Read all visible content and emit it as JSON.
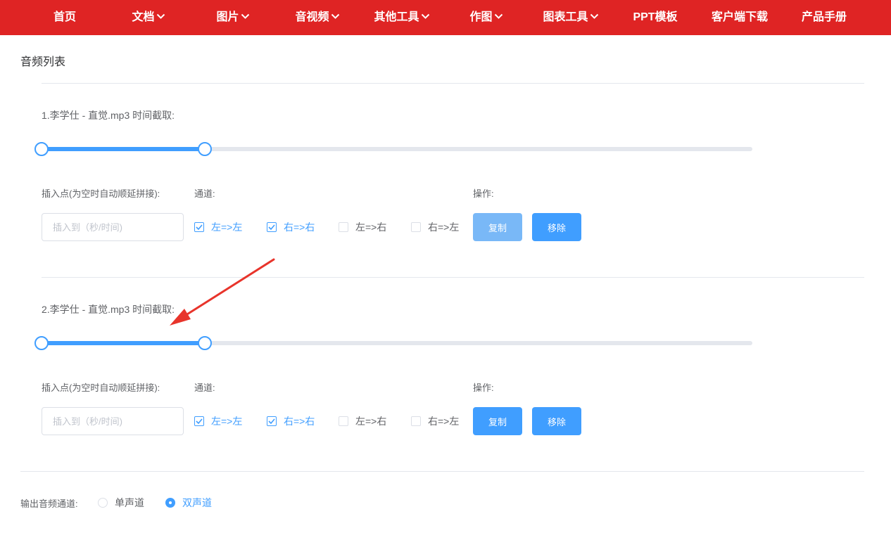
{
  "nav": {
    "items": [
      {
        "label": "首页",
        "dropdown": false
      },
      {
        "label": "文档",
        "dropdown": true
      },
      {
        "label": "图片",
        "dropdown": true
      },
      {
        "label": "音视频",
        "dropdown": true
      },
      {
        "label": "其他工具",
        "dropdown": true
      },
      {
        "label": "作图",
        "dropdown": true
      },
      {
        "label": "图表工具",
        "dropdown": true
      },
      {
        "label": "PPT模板",
        "dropdown": false
      },
      {
        "label": "客户端下载",
        "dropdown": false
      },
      {
        "label": "产品手册",
        "dropdown": false
      }
    ]
  },
  "page": {
    "title": "音频列表"
  },
  "colors": {
    "nav_bg": "#df2424",
    "accent": "#409eff",
    "annotation_arrow": "#e8342b"
  },
  "tracks": [
    {
      "label": "1.李学仕 - 直觉.mp3 时间截取:",
      "slider_range": [
        0,
        0.23
      ],
      "insert_label": "插入点(为空时自动顺延拼接):",
      "insert_placeholder": "插入到（秒/时间)",
      "channel_label": "通道:",
      "channels": [
        {
          "label": "左=>左",
          "checked": true
        },
        {
          "label": "右=>右",
          "checked": true
        },
        {
          "label": "左=>右",
          "checked": false
        },
        {
          "label": "右=>左",
          "checked": false
        }
      ],
      "ops_label": "操作:",
      "copy_label": "复制",
      "copy_disabled": true,
      "remove_label": "移除"
    },
    {
      "label": "2.李学仕 - 直觉.mp3 时间截取:",
      "slider_range": [
        0,
        0.23
      ],
      "insert_label": "插入点(为空时自动顺延拼接):",
      "insert_placeholder": "插入到（秒/时间)",
      "channel_label": "通道:",
      "channels": [
        {
          "label": "左=>左",
          "checked": true
        },
        {
          "label": "右=>右",
          "checked": true
        },
        {
          "label": "左=>右",
          "checked": false
        },
        {
          "label": "右=>左",
          "checked": false
        }
      ],
      "ops_label": "操作:",
      "copy_label": "复制",
      "copy_disabled": false,
      "remove_label": "移除"
    }
  ],
  "output": {
    "label": "输出音频通道:",
    "options": [
      {
        "label": "单声道",
        "selected": false
      },
      {
        "label": "双声道",
        "selected": true
      }
    ]
  }
}
